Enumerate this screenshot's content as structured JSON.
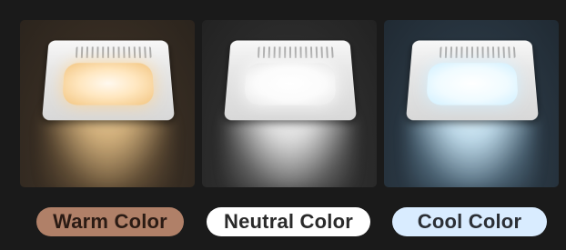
{
  "panels": [
    {
      "id": "warm",
      "label": "Warm Color"
    },
    {
      "id": "neutral",
      "label": "Neutral Color"
    },
    {
      "id": "cool",
      "label": "Cool Color"
    }
  ],
  "colors": {
    "background": "#1a1a1a",
    "warm_label_bg": "#b08068",
    "neutral_label_bg": "#ffffff",
    "cool_label_bg": "#d9ecff",
    "label_text": "#2a2a2a"
  }
}
